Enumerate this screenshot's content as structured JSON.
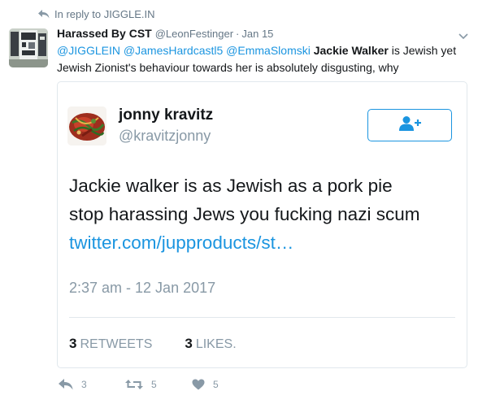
{
  "reply_context": {
    "label": "In reply to JIGGLE.IN"
  },
  "tweet": {
    "fullname": "Harassed By CST",
    "screen_name": "@LeonFestinger",
    "separator": "·",
    "time": "Jan 15",
    "text": {
      "mentions": [
        "@JIGGLEIN",
        "@JamesHardcastl5",
        "@EmmaSlomski"
      ],
      "bold_name": "Jackie Walker",
      "rest_line1": " is Jewish yet",
      "line2": "Jewish Zionist's behaviour towards her is absolutely disgusting, why"
    },
    "actions": {
      "reply_count": "3",
      "retweet_count": "5",
      "like_count": "5"
    }
  },
  "quoted_tweet": {
    "fullname": "jonny kravitz",
    "screen_name": "@kravitzjonny",
    "lines": [
      "Jackie walker is as Jewish as a pork pie",
      "stop harassing Jews you fucking nazi scum"
    ],
    "link": "twitter.com/jupproducts/st…",
    "timestamp": "2:37 am - 12 Jan 2017",
    "stats": {
      "retweets_count": "3",
      "retweets_label": "RETWEETS",
      "likes_count": "3",
      "likes_label": "LIKES."
    }
  },
  "colors": {
    "link": "#1b95e0",
    "muted": "#657786",
    "text": "#14171a",
    "border": "#e1e8ed"
  },
  "icons": {
    "reply_context": "reply-arrow-icon",
    "caret": "chevron-down-icon",
    "follow": "add-user-icon",
    "reply": "reply-icon",
    "retweet": "retweet-icon",
    "like": "heart-icon"
  }
}
